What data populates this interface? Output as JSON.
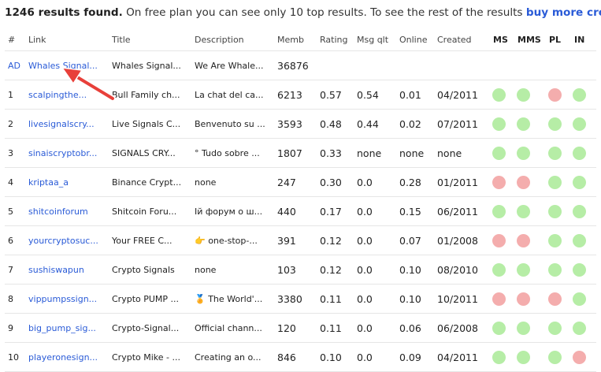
{
  "banner": {
    "count": "1246 results found.",
    "message": " On free plan you can see only 10 top results. To see the rest of the results ",
    "link": "buy more credits"
  },
  "headers": {
    "num": "#",
    "link": "Link",
    "title": "Title",
    "desc": "Description",
    "memb": "Memb",
    "rating": "Rating",
    "msgq": "Msg qlt",
    "online": "Online",
    "created": "Created",
    "ms": "MS",
    "mms": "MMS",
    "pl": "PL",
    "in": "IN"
  },
  "colors": {
    "link": "#2a5bd7",
    "green_dot": "#b6eda6",
    "red_dot": "#f4adad",
    "arrow": "#e8403a"
  },
  "rows": [
    {
      "num": "AD",
      "link": "Whales Signal...",
      "title": "Whales Signal...",
      "desc": "We Are Whale...",
      "memb": "36876",
      "rating": "",
      "msgq": "",
      "online": "",
      "created": "",
      "status": []
    },
    {
      "num": "1",
      "link": "scalpingthe...",
      "title": "Bull Family ch...",
      "desc": "La chat del ca...",
      "memb": "6213",
      "rating": "0.57",
      "msgq": "0.54",
      "online": "0.01",
      "created": "04/2011",
      "status": [
        "green",
        "green",
        "red",
        "green"
      ]
    },
    {
      "num": "2",
      "link": "livesignalscry...",
      "title": "Live Signals C...",
      "desc": "Benvenuto su ...",
      "memb": "3593",
      "rating": "0.48",
      "msgq": "0.44",
      "online": "0.02",
      "created": "07/2011",
      "status": [
        "green",
        "green",
        "green",
        "green"
      ]
    },
    {
      "num": "3",
      "link": "sinaiscryptobr...",
      "title": "SIGNALS CRY...",
      "desc": "° Tudo sobre ...",
      "memb": "1807",
      "rating": "0.33",
      "msgq": "none",
      "online": "none",
      "created": "none",
      "status": [
        "green",
        "green",
        "green",
        "green"
      ]
    },
    {
      "num": "4",
      "link": "kriptaa_a",
      "title": "Binance Crypt...",
      "desc": "none",
      "memb": "247",
      "rating": "0.30",
      "msgq": "0.0",
      "online": "0.28",
      "created": "01/2011",
      "status": [
        "red",
        "red",
        "green",
        "green"
      ]
    },
    {
      "num": "5",
      "link": "shitcoinforum",
      "title": "Shitcoin Foru...",
      "desc": "Ій форум о ш...",
      "memb": "440",
      "rating": "0.17",
      "msgq": "0.0",
      "online": "0.15",
      "created": "06/2011",
      "status": [
        "green",
        "green",
        "green",
        "green"
      ]
    },
    {
      "num": "6",
      "link": "yourcryptosuc...",
      "title": "Your FREE C...",
      "desc": "👉 one-stop-...",
      "memb": "391",
      "rating": "0.12",
      "msgq": "0.0",
      "online": "0.07",
      "created": "01/2008",
      "status": [
        "red",
        "red",
        "green",
        "green"
      ]
    },
    {
      "num": "7",
      "link": "sushiswapun",
      "title": "Crypto Signals",
      "desc": "none",
      "memb": "103",
      "rating": "0.12",
      "msgq": "0.0",
      "online": "0.10",
      "created": "08/2010",
      "status": [
        "green",
        "green",
        "green",
        "green"
      ]
    },
    {
      "num": "8",
      "link": "vippumpssign...",
      "title": "Crypto PUMP ...",
      "desc": "🏅 The World'...",
      "memb": "3380",
      "rating": "0.11",
      "msgq": "0.0",
      "online": "0.10",
      "created": "10/2011",
      "status": [
        "red",
        "red",
        "red",
        "green"
      ]
    },
    {
      "num": "9",
      "link": "big_pump_sig...",
      "title": "Crypto-Signal...",
      "desc": "Official chann...",
      "memb": "120",
      "rating": "0.11",
      "msgq": "0.0",
      "online": "0.06",
      "created": "06/2008",
      "status": [
        "green",
        "green",
        "green",
        "green"
      ]
    },
    {
      "num": "10",
      "link": "playeronesign...",
      "title": "Crypto Mike - ...",
      "desc": "Creating an o...",
      "memb": "846",
      "rating": "0.10",
      "msgq": "0.0",
      "online": "0.09",
      "created": "04/2011",
      "status": [
        "green",
        "green",
        "green",
        "red"
      ]
    }
  ]
}
